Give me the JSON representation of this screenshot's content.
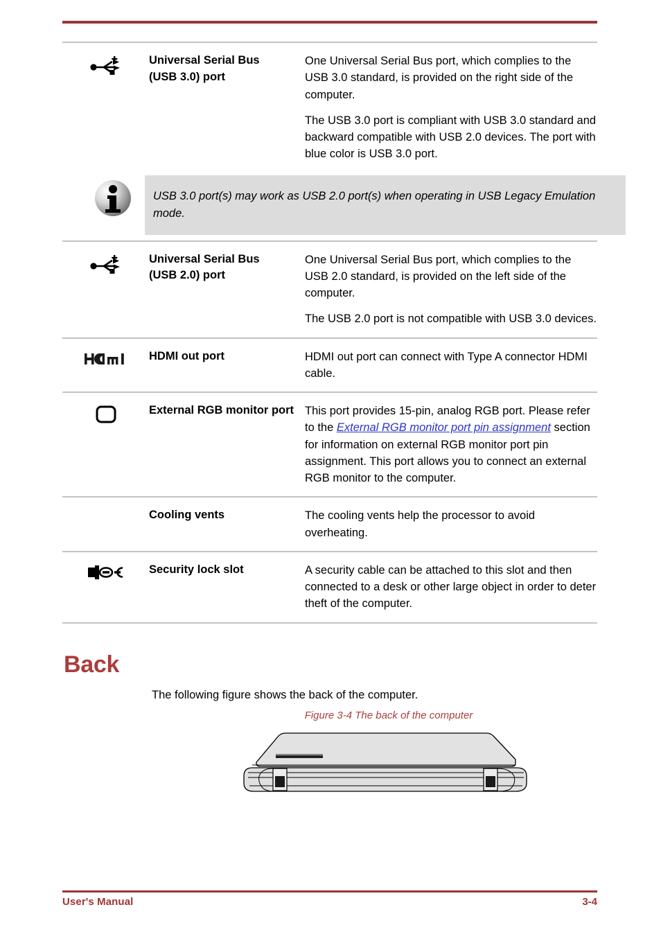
{
  "document": {
    "footer_left": "User's Manual",
    "page_number": "3-4",
    "accent_color": "#9e3535",
    "heading_color": "#ad3c3c",
    "link_color": "#2b35c8",
    "note_background": "#dcdcdc",
    "rule_color": "#c3c3c3"
  },
  "spec_table": {
    "rows": [
      {
        "icon": "usb-icon",
        "name": "Universal Serial Bus\n(USB 3.0) port",
        "name_line1": "Universal Serial Bus",
        "name_line2": "(USB 3.0) port",
        "paragraphs": [
          "One Universal Serial Bus port, which complies to the USB 3.0 standard, is provided on the right side of the computer.",
          "The USB 3.0 port is compliant with USB 3.0 standard and backward compatible with USB 2.0 devices. The port with blue color is USB 3.0 port."
        ]
      },
      {
        "icon": "usb-icon",
        "name_line1": "Universal Serial Bus",
        "name_line2": "(USB 2.0) port",
        "paragraphs": [
          "One Universal Serial Bus port, which complies to the USB 2.0 standard, is provided on the left side of the computer.",
          "The USB 2.0 port is not compatible with USB 3.0 devices."
        ]
      },
      {
        "icon": "hdmi-icon",
        "name_line1": "HDMI out port",
        "name_line2": "",
        "paragraphs": [
          "HDMI out port can connect with Type A connector HDMI cable."
        ]
      },
      {
        "icon": "rgb-monitor-icon",
        "name_line1": "External RGB monitor",
        "name_line2": "port",
        "paragraphs": [],
        "rich_description": {
          "before_link": "This port provides 15-pin, analog RGB port. Please refer to the ",
          "link_text": "External RGB monitor port pin assignment",
          "after_link": " section for information on external RGB monitor port pin assignment. This port allows you to connect an external RGB monitor to the computer."
        }
      },
      {
        "icon": "none",
        "name_line1": "Cooling vents",
        "name_line2": "",
        "paragraphs": [
          "The cooling vents help the processor to avoid overheating."
        ]
      },
      {
        "icon": "security-lock-icon",
        "name_line1": "Security lock slot",
        "name_line2": "",
        "paragraphs": [
          "A security cable can be attached to this slot and then connected to a desk or other large object in order to deter theft of the computer."
        ]
      }
    ]
  },
  "note": {
    "icon": "info-icon",
    "text": "USB 3.0 port(s) may work as USB 2.0 port(s) when operating in USB Legacy Emulation mode."
  },
  "back_section": {
    "heading": "Back",
    "intro": "The following figure shows the back of the computer.",
    "figure_caption": "Figure 3-4 The back of the computer",
    "figure_alt": "laptop-back-illustration"
  }
}
